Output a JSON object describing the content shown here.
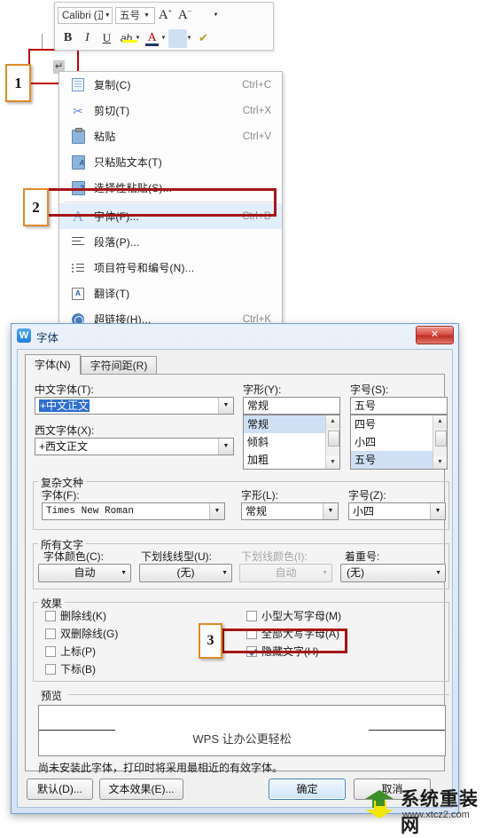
{
  "toolbar": {
    "font_name": "Calibri (正",
    "font_size": "五号",
    "buttons": [
      {
        "name": "grow-font",
        "label": "A+"
      },
      {
        "name": "shrink-font",
        "label": "A-"
      },
      {
        "name": "line-spacing",
        "label": "≡"
      },
      {
        "name": "bold",
        "label": "B"
      },
      {
        "name": "italic",
        "label": "I"
      },
      {
        "name": "underline",
        "label": "U"
      },
      {
        "name": "highlight",
        "label": "ab"
      },
      {
        "name": "font-color",
        "label": "A"
      },
      {
        "name": "align",
        "label": "≡"
      },
      {
        "name": "format-painter",
        "label": "✔"
      }
    ]
  },
  "document": {
    "paragraph_mark": "↵"
  },
  "context_menu": {
    "items": [
      {
        "label": "复制(C)",
        "shortcut": "Ctrl+C",
        "icon": "copy-icon",
        "highlighted": false
      },
      {
        "label": "剪切(T)",
        "shortcut": "Ctrl+X",
        "icon": "scissors-icon",
        "highlighted": false
      },
      {
        "label": "粘贴",
        "shortcut": "Ctrl+V",
        "icon": "paste-icon",
        "highlighted": false
      },
      {
        "label": "只粘贴文本(T)",
        "shortcut": "",
        "icon": "paste-text-icon",
        "highlighted": false
      },
      {
        "label": "选择性粘贴(S)...",
        "shortcut": "",
        "icon": "paste-special-icon",
        "highlighted": false
      },
      {
        "label": "字体(F)...",
        "shortcut": "Ctrl+D",
        "icon": "font-a-icon",
        "highlighted": true
      },
      {
        "label": "段落(P)...",
        "shortcut": "",
        "icon": "paragraph-icon",
        "highlighted": false
      },
      {
        "label": "项目符号和编号(N)...",
        "shortcut": "",
        "icon": "bullets-numbering-icon",
        "highlighted": false
      },
      {
        "label": "翻译(T)",
        "shortcut": "",
        "icon": "translate-icon",
        "highlighted": false
      },
      {
        "label": "超链接(H)...",
        "shortcut": "Ctrl+K",
        "icon": "hyperlink-icon",
        "highlighted": false
      }
    ]
  },
  "markers": {
    "one": "1",
    "two": "2",
    "three": "3"
  },
  "dialog": {
    "title": "字体",
    "icon_letter": "W",
    "close_label": "✕",
    "tabs": [
      {
        "label": "字体(N)",
        "active": true
      },
      {
        "label": "字符间距(R)",
        "active": false
      }
    ],
    "chinese_font": {
      "label": "中文字体(T):",
      "value": "+中文正文"
    },
    "western_font": {
      "label": "西文字体(X):",
      "value": "+西文正文"
    },
    "font_style": {
      "label": "字形(Y):",
      "value": "常规",
      "options": [
        "常规",
        "倾斜",
        "加粗"
      ],
      "selected": "常规"
    },
    "font_size": {
      "label": "字号(S):",
      "value": "五号",
      "options": [
        "四号",
        "小四",
        "五号"
      ],
      "selected": "五号"
    },
    "complex_script": {
      "group_label": "复杂文种",
      "font": {
        "label": "字体(F):",
        "value": "Times New Roman"
      },
      "style": {
        "label": "字形(L):",
        "value": "常规"
      },
      "size": {
        "label": "字号(Z):",
        "value": "小四"
      }
    },
    "all_text": {
      "group_label": "所有文字",
      "font_color": {
        "label": "字体颜色(C):",
        "value": "自动",
        "disabled": false
      },
      "underline_style": {
        "label": "下划线线型(U):",
        "value": "(无)",
        "disabled": false
      },
      "underline_color": {
        "label": "下划线颜色(I):",
        "value": "自动",
        "disabled": true
      },
      "emphasis_mark": {
        "label": "着重号:",
        "value": "(无)",
        "disabled": false
      }
    },
    "effects": {
      "group_label": "效果",
      "left": [
        {
          "label": "删除线(K)",
          "checked": false
        },
        {
          "label": "双删除线(G)",
          "checked": false
        },
        {
          "label": "上标(P)",
          "checked": false
        },
        {
          "label": "下标(B)",
          "checked": false
        }
      ],
      "right": [
        {
          "label": "小型大写字母(M)",
          "checked": false
        },
        {
          "label": "全部大写字母(A)",
          "checked": false
        },
        {
          "label": "隐藏文字(H)",
          "checked": true
        }
      ]
    },
    "preview": {
      "group_label": "预览",
      "text": "WPS 让办公更轻松",
      "note": "尚未安装此字体，打印时将采用最相近的有效字体。"
    },
    "buttons": {
      "default": "默认(D)...",
      "text_effects": "文本效果(E)...",
      "ok": "确定",
      "cancel": "取消"
    }
  },
  "watermark": {
    "title": "系统重装网",
    "url": "www.xtcz2.com"
  }
}
